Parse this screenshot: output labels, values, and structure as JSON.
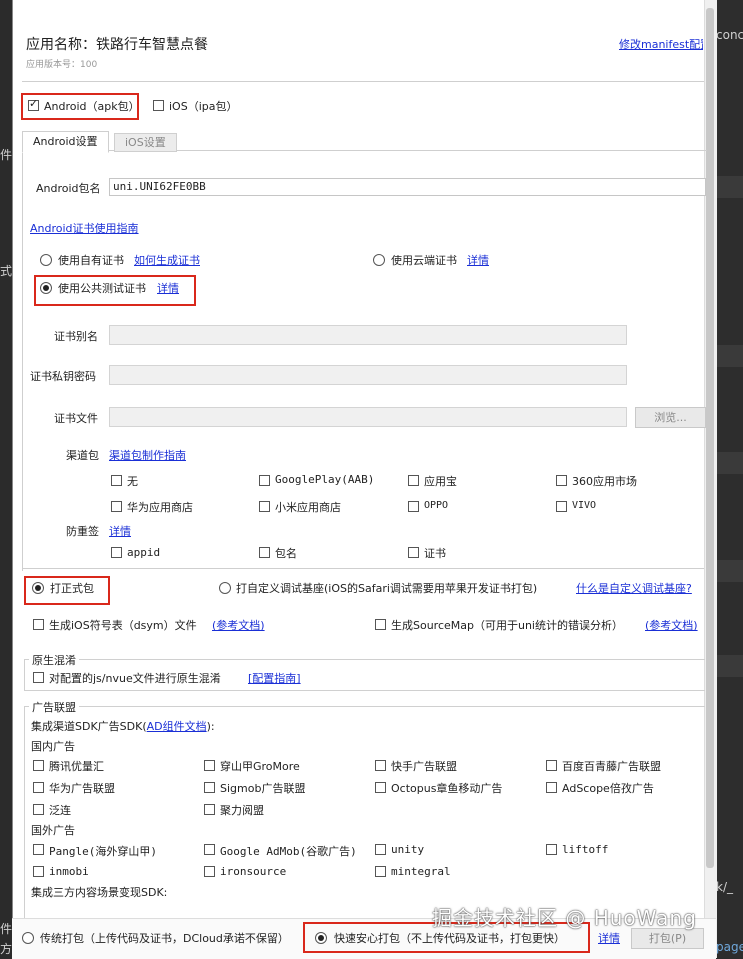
{
  "app": {
    "name_label": "应用名称：铁路行车智慧点餐",
    "version_label": "应用版本号：100",
    "edit_manifest_link": "修改manifest配置"
  },
  "platforms": {
    "android": {
      "label": "Android（apk包）",
      "checked": true
    },
    "ios": {
      "label": "iOS（ipa包）",
      "checked": false
    }
  },
  "tabs": [
    {
      "label": "Android设置",
      "active": true
    },
    {
      "label": "iOS设置",
      "active": false
    }
  ],
  "package": {
    "label": "Android包名",
    "value": "uni.UNI62FE0BB"
  },
  "cert_guide_link": "Android证书使用指南",
  "cert_options": {
    "own": {
      "label": "使用自有证书",
      "link": "如何生成证书",
      "selected": false
    },
    "cloud": {
      "label": "使用云端证书",
      "link": "详情",
      "selected": false
    },
    "public": {
      "label": "使用公共测试证书",
      "link": "详情",
      "selected": true
    }
  },
  "cert_fields": {
    "alias_label": "证书别名",
    "password_label": "证书私钥密码",
    "file_label": "证书文件",
    "browse_label": "浏览..."
  },
  "channels": {
    "label": "渠道包",
    "guide_link": "渠道包制作指南",
    "items": [
      "无",
      "GooglePlay(AAB)",
      "应用宝",
      "360应用市场",
      "华为应用商店",
      "小米应用商店",
      "OPPO",
      "VIVO"
    ]
  },
  "anti_repack": {
    "label": "防重签",
    "link": "详情",
    "items": [
      "appid",
      "包名",
      "证书"
    ]
  },
  "build_type": {
    "release": {
      "label": "打正式包",
      "selected": true
    },
    "custom_base": {
      "label": "打自定义调试基座(iOS的Safari调试需要用苹果开发证书打包)",
      "selected": false
    },
    "custom_base_link": "什么是自定义调试基座?"
  },
  "symbols": {
    "dsym": {
      "label": "生成iOS符号表（dsym）文件",
      "link": "(参考文档)"
    },
    "sourcemap": {
      "label": "生成SourceMap（可用于uni统计的错误分析）",
      "link": "(参考文档)"
    }
  },
  "obfuscation": {
    "title": "原生混淆",
    "checkbox_label": "对配置的js/nvue文件进行原生混淆",
    "link": "[配置指南]"
  },
  "ads": {
    "title": "广告联盟",
    "integrate_label_prefix": "集成渠道SDK广告SDK(",
    "integrate_link": "AD组件文档",
    "integrate_label_suffix": "):",
    "domestic_label": "国内广告",
    "domestic": [
      "腾讯优量汇",
      "穿山甲GroMore",
      "快手广告联盟",
      "百度百青藤广告联盟",
      "华为广告联盟",
      "Sigmob广告联盟",
      "Octopus章鱼移动广告",
      "AdScope倍孜广告",
      "泛连",
      "聚力阅盟"
    ],
    "foreign_label": "国外广告",
    "foreign": [
      "Pangle(海外穿山甲)",
      "Google AdMob(谷歌广告)",
      "unity",
      "liftoff",
      "inmobi",
      "ironsource",
      "mintegral"
    ],
    "third_party_label": "集成三方内容场景变现SDK:"
  },
  "footer": {
    "traditional": {
      "label": "传统打包（上传代码及证书，DCloud承诺不保留）",
      "selected": false
    },
    "fast": {
      "label": "快速安心打包（不上传代码及证书，打包更快）",
      "selected": true
    },
    "detail_link": "详情",
    "build_button": "打包(P)"
  },
  "watermark": "掘金技术社区 @ HuoWang",
  "editor_fragments": {
    "right_top": "conc",
    "left_1": "件",
    "left_2": "式",
    "right_mid": "k/_",
    "left_bottom_1": "件:",
    "left_bottom_2": "方",
    "right_bottom": "page"
  },
  "colors": {
    "link": "#1a2fd6",
    "highlight_box": "#d9281b"
  }
}
